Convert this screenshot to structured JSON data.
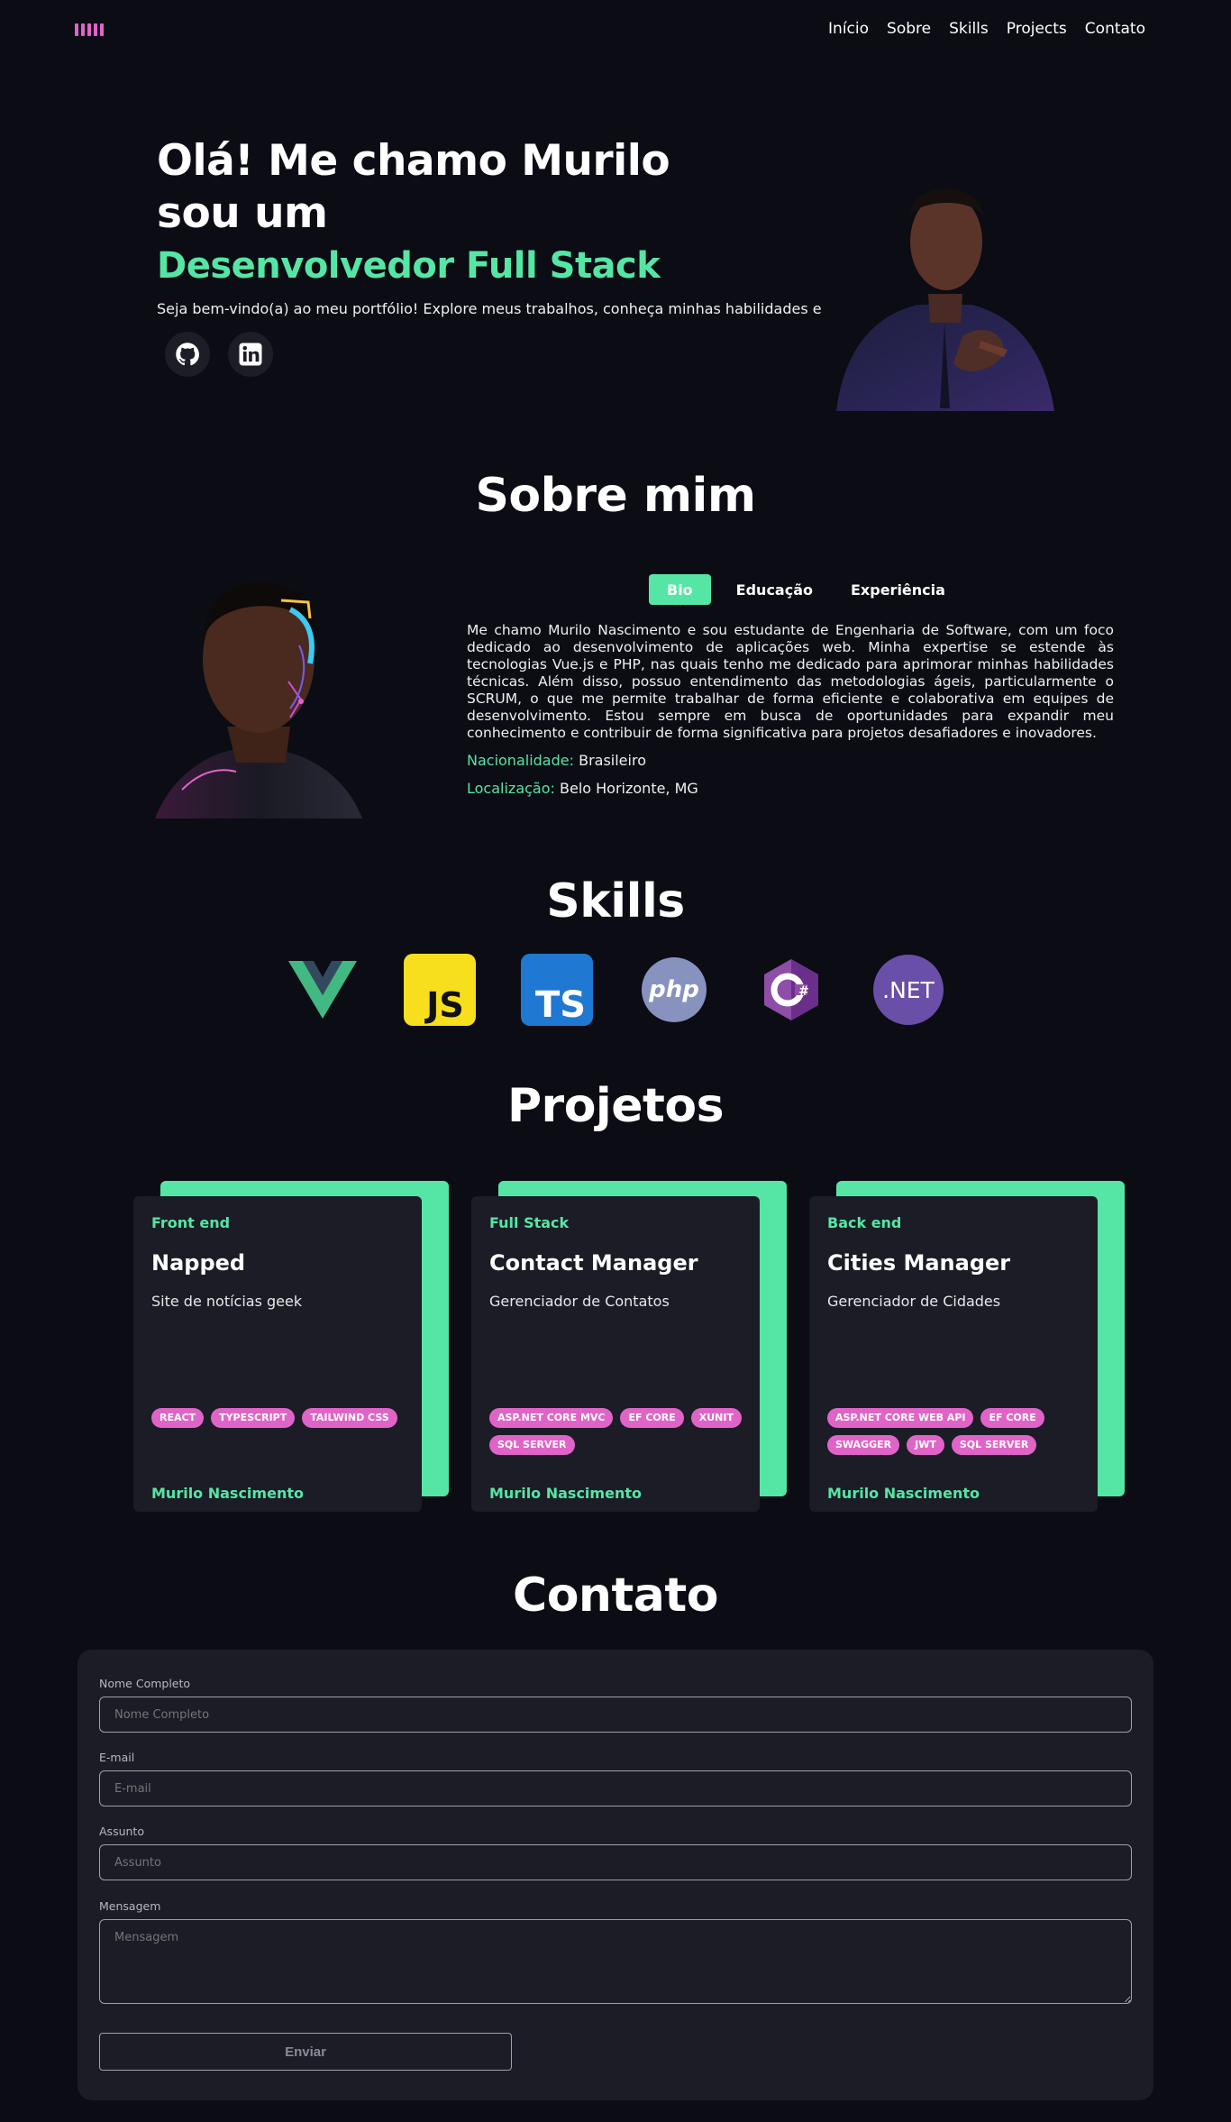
{
  "nav": {
    "links": [
      "Início",
      "Sobre",
      "Skills",
      "Projects",
      "Contato"
    ]
  },
  "hero": {
    "title_line1": "Olá! Me chamo Murilo",
    "title_line2": "sou um",
    "role": "Desenvolvedor Full Stack",
    "subtitle": "Seja bem-vindo(a) ao meu portfólio! Explore meus trabalhos, conheça minhas habilidades e ideias.",
    "social": [
      "github-icon",
      "linkedin-icon"
    ]
  },
  "about": {
    "title": "Sobre mim",
    "tabs": [
      "Bio",
      "Educação",
      "Experiência"
    ],
    "active_tab": "Bio",
    "bio": "Me chamo Murilo Nascimento e sou estudante de Engenharia de Software, com um foco dedicado ao desenvolvimento de aplicações web. Minha expertise se estende às tecnologias Vue.js e PHP, nas quais tenho me dedicado para aprimorar minhas habilidades técnicas. Além disso, possuo entendimento das metodologias ágeis, particularmente o SCRUM, o que me permite trabalhar de forma eficiente e colaborativa em equipes de desenvolvimento. Estou sempre em busca de oportunidades para expandir meu conhecimento e contribuir de forma significativa para projetos desafiadores e inovadores.",
    "nationality_label": "Nacionalidade:",
    "nationality": "Brasileiro",
    "location_label": "Localização:",
    "location": "Belo Horizonte, MG"
  },
  "skills": {
    "title": "Skills",
    "items": [
      "vue-icon",
      "javascript-icon",
      "typescript-icon",
      "php-icon",
      "csharp-icon",
      "dotnet-icon"
    ],
    "js_text": "JS",
    "ts_text": "TS",
    "php_text": "php",
    "dotnet_text": ".NET"
  },
  "projects": {
    "title": "Projetos",
    "cards": [
      {
        "category": "Front end",
        "title": "Napped",
        "description": "Site de notícias geek",
        "tags": [
          "REACT",
          "TYPESCRIPT",
          "TAILWIND CSS"
        ],
        "author": "Murilo Nascimento"
      },
      {
        "category": "Full Stack",
        "title": "Contact Manager",
        "description": "Gerenciador de Contatos",
        "tags": [
          "ASP.NET CORE MVC",
          "EF CORE",
          "XUNIT",
          "SQL SERVER"
        ],
        "author": "Murilo Nascimento"
      },
      {
        "category": "Back end",
        "title": "Cities Manager",
        "description": "Gerenciador de Cidades",
        "tags": [
          "ASP.NET CORE WEB API",
          "EF CORE",
          "SWAGGER",
          "JWT",
          "SQL SERVER"
        ],
        "author": "Murilo Nascimento"
      }
    ]
  },
  "contact": {
    "title": "Contato",
    "fields": [
      {
        "label": "Nome Completo",
        "placeholder": "Nome Completo"
      },
      {
        "label": "E-mail",
        "placeholder": "E-mail"
      },
      {
        "label": "Assunto",
        "placeholder": "Assunto"
      },
      {
        "label": "Mensagem",
        "placeholder": "Mensagem"
      }
    ],
    "submit": "Enviar"
  },
  "colors": {
    "background": "#0b0c14",
    "accent_green": "#55e6a5",
    "accent_pink": "#e064c8",
    "card": "#1b1c26"
  }
}
